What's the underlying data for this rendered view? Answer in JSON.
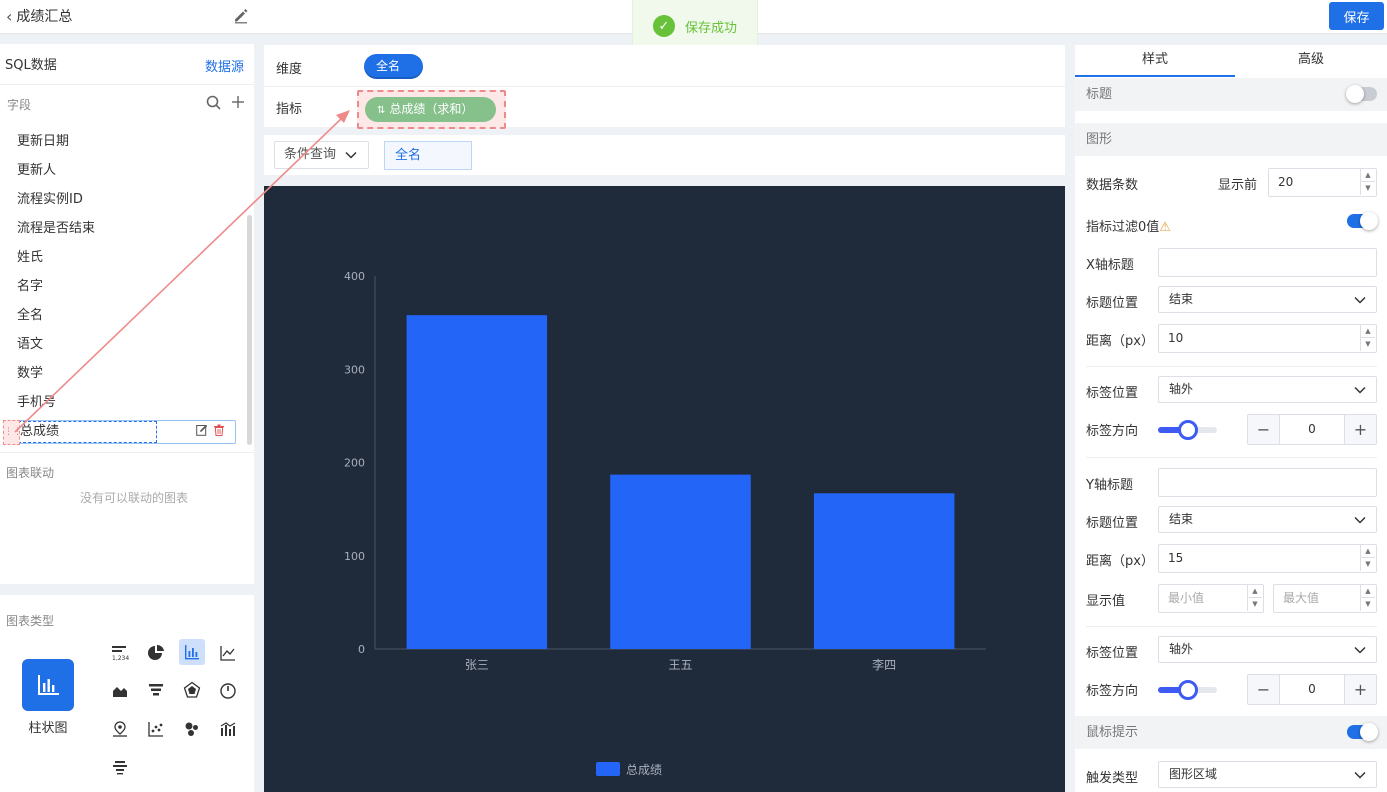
{
  "header": {
    "title": "成绩汇总",
    "save_label": "保存"
  },
  "toast": {
    "message": "保存成功"
  },
  "left": {
    "source_title": "SQL数据",
    "datasource_link": "数据源",
    "fields_label": "字段",
    "fields": [
      "更新日期",
      "更新人",
      "流程实例ID",
      "流程是否结束",
      "姓氏",
      "名字",
      "全名",
      "语文",
      "数学",
      "手机号"
    ],
    "selected_field": "总成绩",
    "linkage_label": "图表联动",
    "linkage_empty": "没有可以联动的图表",
    "chart_type_label": "图表类型",
    "chart_type_selected": "柱状图",
    "chart_type_icons": [
      "table-number-icon",
      "pie-chart-icon",
      "bar-chart-icon",
      "line-chart-icon",
      "area-chart-icon",
      "funnel-chart-icon",
      "radar-chart-icon",
      "gauge-chart-icon",
      "map-pin-icon",
      "scatter-chart-icon",
      "bubble-map-icon",
      "combo-chart-icon",
      "word-cloud-icon"
    ]
  },
  "center": {
    "dimension_label": "维度",
    "dimension_pill": "全名",
    "metric_label": "指标",
    "metric_pill": "总成绩（求和）",
    "condition_select": "条件查询",
    "condition_tag": "全名"
  },
  "chart_data": {
    "type": "bar",
    "categories": [
      "张三",
      "王五",
      "李四"
    ],
    "series": [
      {
        "name": "总成绩",
        "values": [
          358,
          187,
          167
        ]
      }
    ],
    "ylim": [
      0,
      400
    ],
    "yticks": [
      0,
      100,
      200,
      300,
      400
    ],
    "legend_position": "bottom-center",
    "bar_color": "#2366f7",
    "background": "#1f2a3b"
  },
  "right": {
    "tabs": [
      "样式",
      "高级"
    ],
    "title_section": "标题",
    "shape_section": "图形",
    "data_count_label": "数据条数",
    "show_first_label": "显示前",
    "show_first_value": "20",
    "filter_zero_label": "指标过滤0值",
    "x_title_label": "X轴标题",
    "x_title_value": "",
    "x_title_pos_label": "标题位置",
    "x_title_pos_value": "结束",
    "x_distance_label": "距离（px）",
    "x_distance_value": "10",
    "x_label_pos_label": "标签位置",
    "x_label_pos_value": "轴外",
    "x_label_dir_label": "标签方向",
    "x_label_dir_value": "0",
    "y_title_label": "Y轴标题",
    "y_title_value": "",
    "y_title_pos_label": "标题位置",
    "y_title_pos_value": "结束",
    "y_distance_label": "距离（px）",
    "y_distance_value": "15",
    "display_value_label": "显示值",
    "min_placeholder": "最小值",
    "max_placeholder": "最大值",
    "y_label_pos_label": "标签位置",
    "y_label_pos_value": "轴外",
    "y_label_dir_label": "标签方向",
    "y_label_dir_value": "0",
    "tooltip_section": "鼠标提示",
    "trigger_label": "触发类型",
    "trigger_value": "图形区域",
    "accent_color": "#1f6fe6"
  }
}
